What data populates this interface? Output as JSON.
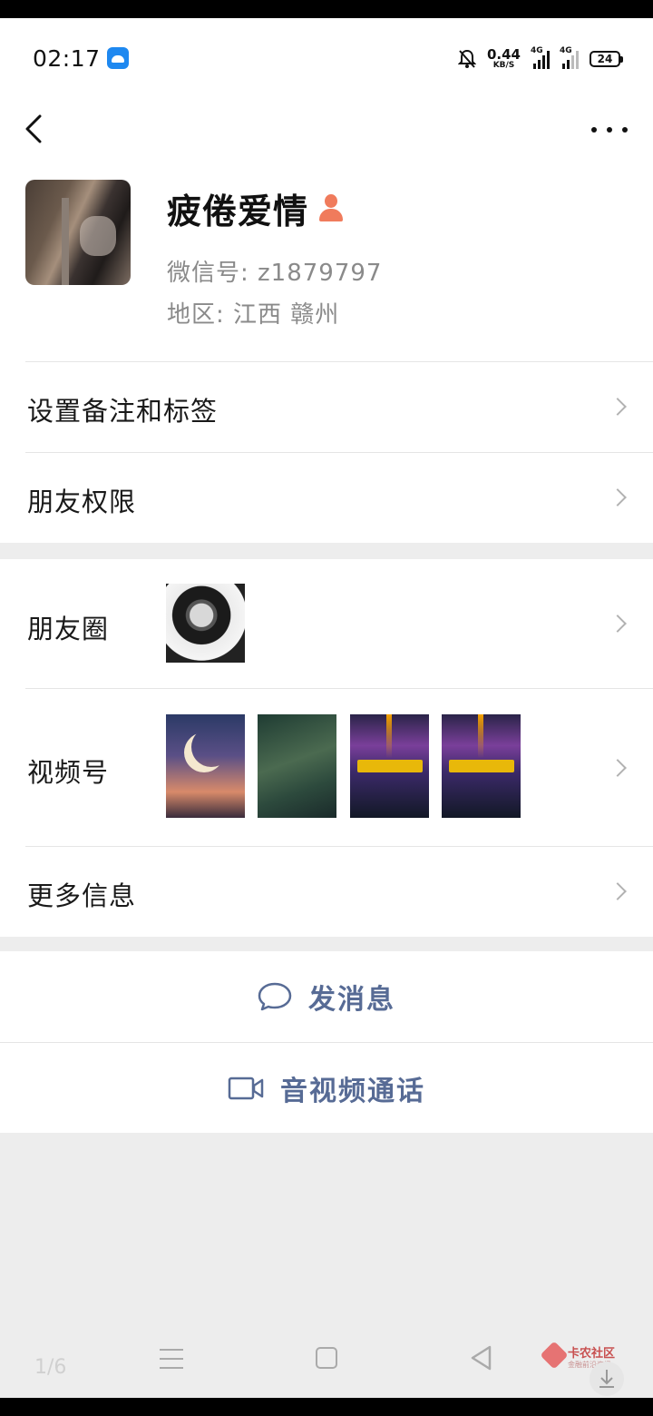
{
  "status_bar": {
    "time": "02:17",
    "net_speed_value": "0.44",
    "net_speed_unit": "KB/S",
    "sim1": "4G",
    "sim2": "4G",
    "battery": "24"
  },
  "profile": {
    "name": "疲倦爱情",
    "wechat_id": "微信号: z1879797",
    "region": "地区: 江西  赣州"
  },
  "menu": {
    "remark_tags": "设置备注和标签",
    "friend_permissions": "朋友权限",
    "moments": "朋友圈",
    "channels": "视频号",
    "more_info": "更多信息"
  },
  "actions": {
    "send_message": "发消息",
    "video_call": "音视频通话"
  },
  "system_nav": {
    "page_indicator": "1/6",
    "watermark_title": "卡农社区",
    "watermark_sub": "金融前沿资讯"
  },
  "colors": {
    "accent_link": "#576b95",
    "gender_icon": "#f07b5c",
    "background": "#ededed"
  }
}
